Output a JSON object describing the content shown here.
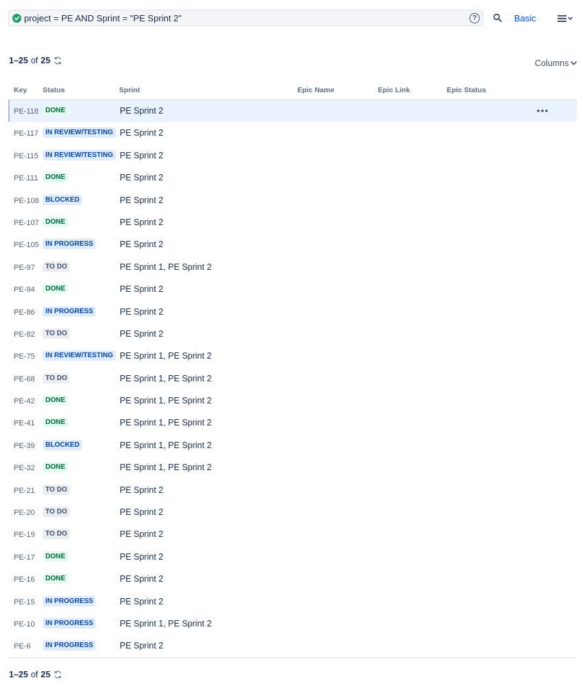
{
  "search": {
    "query": "project = PE AND Sprint = \"PE Sprint 2\"",
    "status_icon": "check-circle-icon",
    "help_icon": "question-circle-icon",
    "help_glyph": "?",
    "search_icon": "magnifier-icon",
    "mode_label": "Basic",
    "menu_icon": "hamburger-menu-icon"
  },
  "pagination": {
    "range": "1–25",
    "of": "of",
    "total": "25"
  },
  "columns_button": "Columns",
  "table": {
    "headers": [
      "Key",
      "Status",
      "Sprint",
      "Epic Name",
      "Epic Link",
      "Epic Status"
    ],
    "rows": [
      {
        "key": "PE-118",
        "status": "DONE",
        "sprint": "PE Sprint 2"
      },
      {
        "key": "PE-117",
        "status": "IN REVIEW/TESTING",
        "sprint": "PE Sprint 2"
      },
      {
        "key": "PE-115",
        "status": "IN REVIEW/TESTING",
        "sprint": "PE Sprint 2"
      },
      {
        "key": "PE-111",
        "status": "DONE",
        "sprint": "PE Sprint 2"
      },
      {
        "key": "PE-108",
        "status": "BLOCKED",
        "sprint": "PE Sprint 2"
      },
      {
        "key": "PE-107",
        "status": "DONE",
        "sprint": "PE Sprint 2"
      },
      {
        "key": "PE-105",
        "status": "IN PROGRESS",
        "sprint": "PE Sprint 2"
      },
      {
        "key": "PE-97",
        "status": "TO DO",
        "sprint": "PE Sprint 1, PE Sprint 2"
      },
      {
        "key": "PE-94",
        "status": "DONE",
        "sprint": "PE Sprint 2"
      },
      {
        "key": "PE-86",
        "status": "IN PROGRESS",
        "sprint": "PE Sprint 2"
      },
      {
        "key": "PE-82",
        "status": "TO DO",
        "sprint": "PE Sprint 2"
      },
      {
        "key": "PE-75",
        "status": "IN REVIEW/TESTING",
        "sprint": "PE Sprint 1, PE Sprint 2"
      },
      {
        "key": "PE-68",
        "status": "TO DO",
        "sprint": "PE Sprint 1, PE Sprint 2"
      },
      {
        "key": "PE-42",
        "status": "DONE",
        "sprint": "PE Sprint 1, PE Sprint 2"
      },
      {
        "key": "PE-41",
        "status": "DONE",
        "sprint": "PE Sprint 1, PE Sprint 2"
      },
      {
        "key": "PE-39",
        "status": "BLOCKED",
        "sprint": "PE Sprint 1, PE Sprint 2"
      },
      {
        "key": "PE-32",
        "status": "DONE",
        "sprint": "PE Sprint 1, PE Sprint 2"
      },
      {
        "key": "PE-21",
        "status": "TO DO",
        "sprint": "PE Sprint 2"
      },
      {
        "key": "PE-20",
        "status": "TO DO",
        "sprint": "PE Sprint 2"
      },
      {
        "key": "PE-19",
        "status": "TO DO",
        "sprint": "PE Sprint 2"
      },
      {
        "key": "PE-17",
        "status": "DONE",
        "sprint": "PE Sprint 2"
      },
      {
        "key": "PE-16",
        "status": "DONE",
        "sprint": "PE Sprint 2"
      },
      {
        "key": "PE-15",
        "status": "IN PROGRESS",
        "sprint": "PE Sprint 2"
      },
      {
        "key": "PE-10",
        "status": "IN PROGRESS",
        "sprint": "PE Sprint 1, PE Sprint 2"
      },
      {
        "key": "PE-6",
        "status": "IN PROGRESS",
        "sprint": "PE Sprint 2"
      }
    ],
    "row_action_icon": "more-horizontal-icon"
  },
  "colors": {
    "accent": "#0052cc",
    "done_bg": "#e3fcef",
    "done_text": "#006644",
    "in_progress_bg": "#deebff",
    "in_progress_text": "#0747a6",
    "todo_bg": "#ebecf0",
    "todo_text": "#42526e",
    "selected_row_bg": "#e9f2fe",
    "valid_icon": "#22a06b"
  }
}
